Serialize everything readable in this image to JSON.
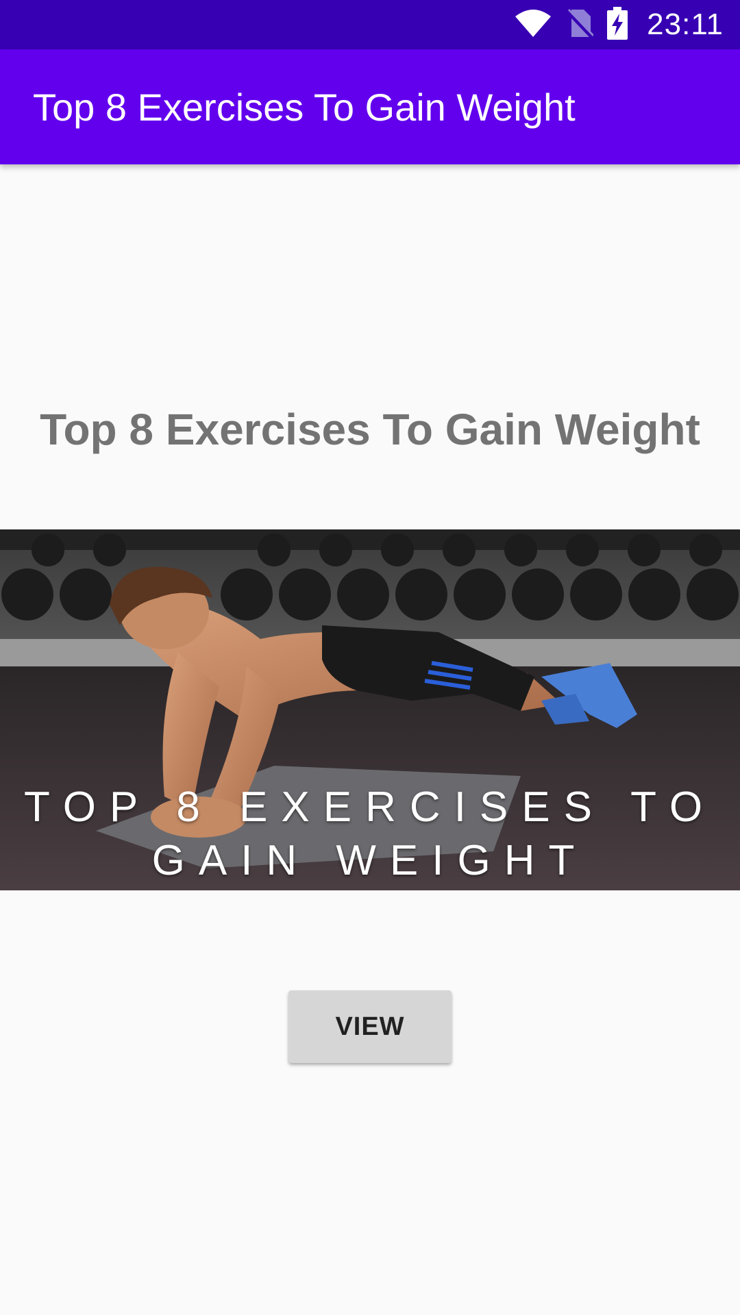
{
  "status_bar": {
    "time": "23:11",
    "icons": [
      "wifi-icon",
      "no-sim-icon",
      "battery-charging-icon"
    ]
  },
  "app_bar": {
    "title": "Top 8 Exercises To Gain Weight"
  },
  "main": {
    "title": "Top 8 Exercises To Gain Weight",
    "hero_image": {
      "caption_line1": "TOP 8 EXERCISES TO",
      "caption_line2": "GAIN WEIGHT"
    },
    "view_button_label": "VIEW"
  },
  "colors": {
    "status_bar": "#3700b3",
    "app_bar": "#6200ee",
    "background": "#fafafa",
    "title_text": "#737373",
    "button": "#d6d6d6"
  }
}
